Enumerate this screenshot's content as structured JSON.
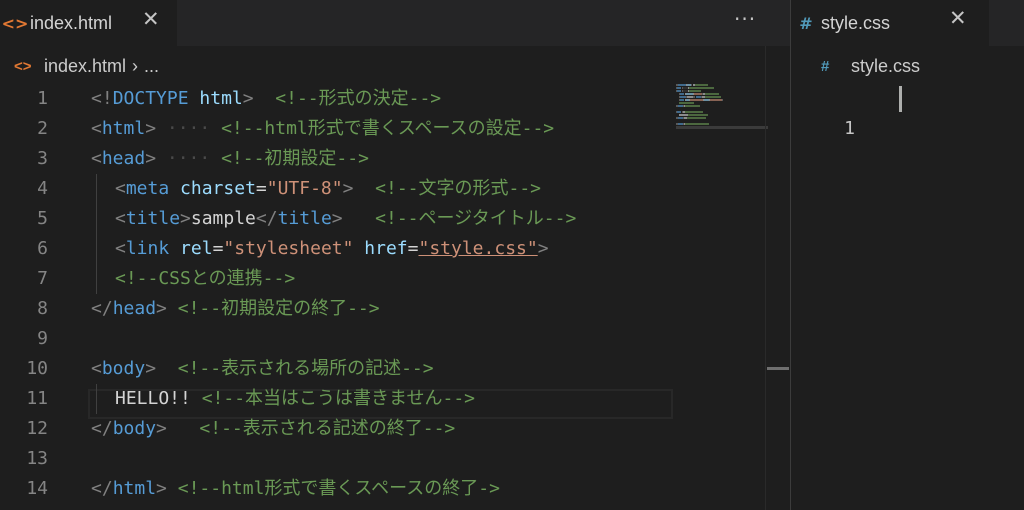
{
  "left_editor": {
    "tab": {
      "icon": "<>",
      "label": "index.html",
      "close": "✕"
    },
    "more": "···",
    "breadcrumb": {
      "icon": "<>",
      "file": "index.html",
      "separator": "›",
      "more": "..."
    },
    "lines": [
      {
        "num": "1",
        "parts": [
          [
            "punct",
            "<!"
          ],
          [
            "tag",
            "DOCTYPE"
          ],
          [
            "txt",
            " "
          ],
          [
            "attr",
            "html"
          ],
          [
            "punct",
            ">"
          ],
          [
            "txt",
            "  "
          ],
          [
            "cmt",
            "<!--形式の決定-->"
          ]
        ]
      },
      {
        "num": "2",
        "parts": [
          [
            "punct",
            "<"
          ],
          [
            "tag",
            "html"
          ],
          [
            "punct",
            ">"
          ],
          [
            "ws",
            " ····"
          ],
          [
            "txt",
            " "
          ],
          [
            "cmt",
            "<!--html形式で書くスペースの設定-->"
          ]
        ]
      },
      {
        "num": "3",
        "parts": [
          [
            "punct",
            "<"
          ],
          [
            "tag",
            "head"
          ],
          [
            "punct",
            ">"
          ],
          [
            "ws",
            " ····"
          ],
          [
            "txt",
            " "
          ],
          [
            "cmt",
            "<!--初期設定-->"
          ]
        ]
      },
      {
        "num": "4",
        "indent": true,
        "parts": [
          [
            "punct",
            "<"
          ],
          [
            "tag",
            "meta"
          ],
          [
            "txt",
            " "
          ],
          [
            "attr",
            "charset"
          ],
          [
            "txt",
            "="
          ],
          [
            "str",
            "\"UTF-8\""
          ],
          [
            "punct",
            ">"
          ],
          [
            "txt",
            "  "
          ],
          [
            "cmt",
            "<!--文字の形式-->"
          ]
        ]
      },
      {
        "num": "5",
        "indent": true,
        "parts": [
          [
            "punct",
            "<"
          ],
          [
            "tag",
            "title"
          ],
          [
            "punct",
            ">"
          ],
          [
            "txt",
            "sample"
          ],
          [
            "punct",
            "</"
          ],
          [
            "tag",
            "title"
          ],
          [
            "punct",
            ">"
          ],
          [
            "txt",
            "   "
          ],
          [
            "cmt",
            "<!--ページタイトル-->"
          ]
        ]
      },
      {
        "num": "6",
        "indent": true,
        "parts": [
          [
            "punct",
            "<"
          ],
          [
            "tag",
            "link"
          ],
          [
            "txt",
            " "
          ],
          [
            "attr",
            "rel"
          ],
          [
            "txt",
            "="
          ],
          [
            "str",
            "\"stylesheet\""
          ],
          [
            "txt",
            " "
          ],
          [
            "attr",
            "href"
          ],
          [
            "txt",
            "="
          ],
          [
            "strlink",
            "\"style.css\""
          ],
          [
            "punct",
            ">"
          ]
        ]
      },
      {
        "num": "7",
        "indent": true,
        "parts": [
          [
            "cmt",
            "<!--CSSとの連携-->"
          ]
        ]
      },
      {
        "num": "8",
        "parts": [
          [
            "punct",
            "</"
          ],
          [
            "tag",
            "head"
          ],
          [
            "punct",
            ">"
          ],
          [
            "txt",
            " "
          ],
          [
            "cmt",
            "<!--初期設定の終了-->"
          ]
        ]
      },
      {
        "num": "9",
        "parts": []
      },
      {
        "num": "10",
        "parts": [
          [
            "punct",
            "<"
          ],
          [
            "tag",
            "body"
          ],
          [
            "punct",
            ">"
          ],
          [
            "txt",
            "  "
          ],
          [
            "cmt",
            "<!--表示される場所の記述-->"
          ]
        ]
      },
      {
        "num": "11",
        "indent": true,
        "parts": [
          [
            "txt",
            "HELLO!! "
          ],
          [
            "cmt",
            "<!--本当はこうは書きません-->"
          ]
        ]
      },
      {
        "num": "12",
        "parts": [
          [
            "punct",
            "</"
          ],
          [
            "tag",
            "body"
          ],
          [
            "punct",
            ">"
          ],
          [
            "txt",
            "   "
          ],
          [
            "cmt",
            "<!--表示される記述の終了-->"
          ]
        ]
      },
      {
        "num": "13",
        "parts": []
      },
      {
        "num": "14",
        "parts": [
          [
            "punct",
            "</"
          ],
          [
            "tag",
            "html"
          ],
          [
            "punct",
            ">"
          ],
          [
            "txt",
            " "
          ],
          [
            "cmt",
            "<!--html形式で書くスペースの終了->"
          ]
        ]
      }
    ]
  },
  "right_editor": {
    "tab": {
      "icon": "#",
      "label": "style.css",
      "close": "✕"
    },
    "breadcrumb": {
      "icon": "#",
      "file": "style.css"
    },
    "lines": [
      {
        "num": "1"
      }
    ]
  },
  "colors": {
    "background": "#1e1e1e",
    "tag": "#569cd6",
    "attribute": "#9cdcfe",
    "string": "#ce9178",
    "comment": "#6a9955",
    "html_icon": "#e37933",
    "css_icon": "#519aba"
  },
  "icons": {
    "html_file": "angle-brackets-icon",
    "css_file": "hash-icon",
    "close": "close-icon",
    "more": "more-actions-icon",
    "breadcrumb_separator": "chevron-right-icon"
  }
}
